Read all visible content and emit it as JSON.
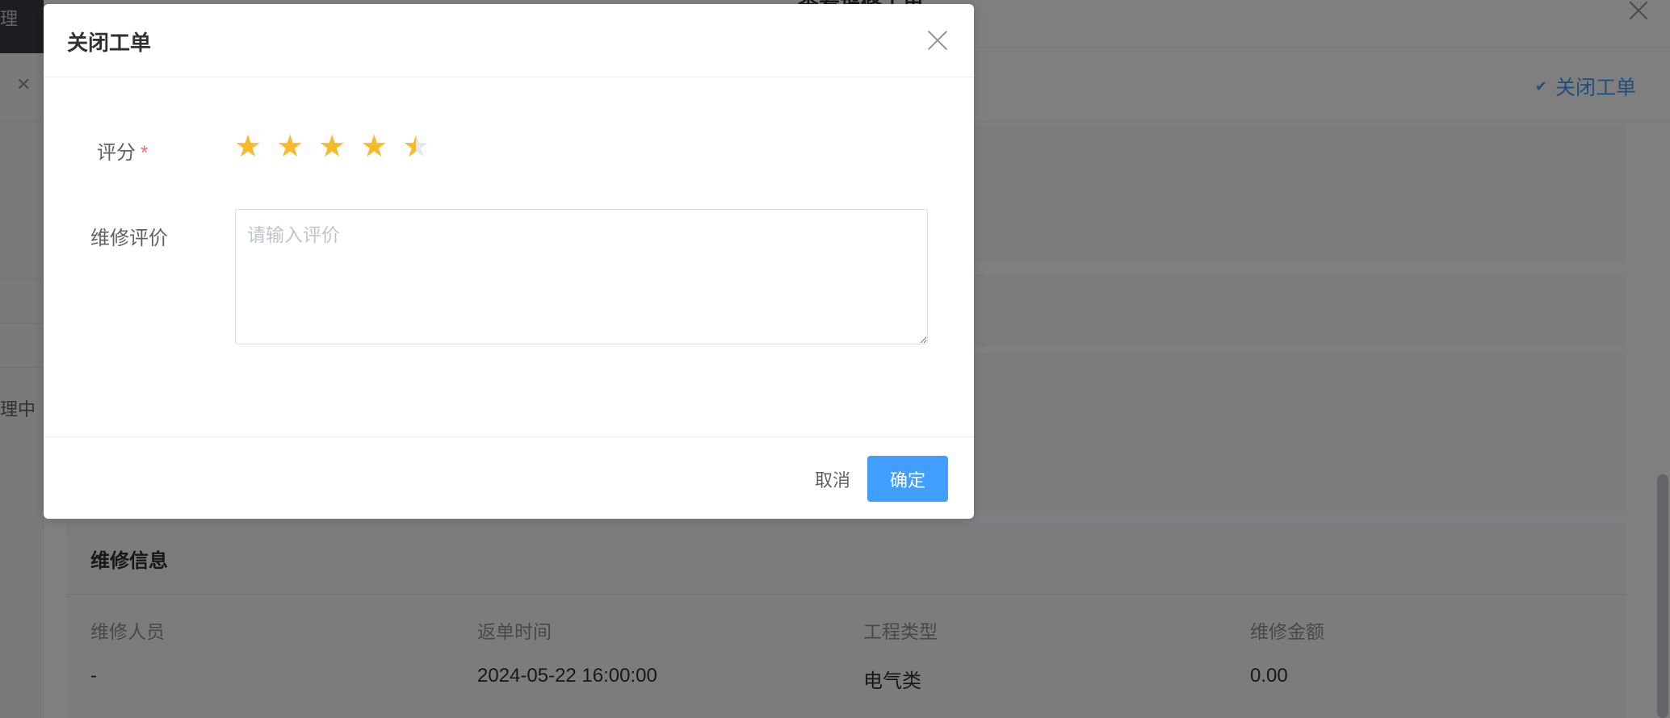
{
  "background": {
    "sidebar_fragment_top": "理",
    "sidebar_status_fragment": "理中",
    "drawer_title": "查看报修工单",
    "close_order_label": "关闭工单",
    "repair_info": {
      "title": "维修信息",
      "labels": [
        "维修人员",
        "返单时间",
        "工程类型",
        "维修金额"
      ],
      "values": [
        "-",
        "2024-05-22 16:00:00",
        "电气类",
        "0.00"
      ]
    }
  },
  "dialog": {
    "title": "关闭工单",
    "score_label": "评分",
    "required_mark": "*",
    "rating": 4.5,
    "rating_max": 5,
    "star_color": "#f7ba2a",
    "comment_label": "维修评价",
    "comment_placeholder": "请输入评价",
    "comment_value": "",
    "cancel_label": "取消",
    "confirm_label": "确定",
    "accent_color": "#409eff"
  }
}
